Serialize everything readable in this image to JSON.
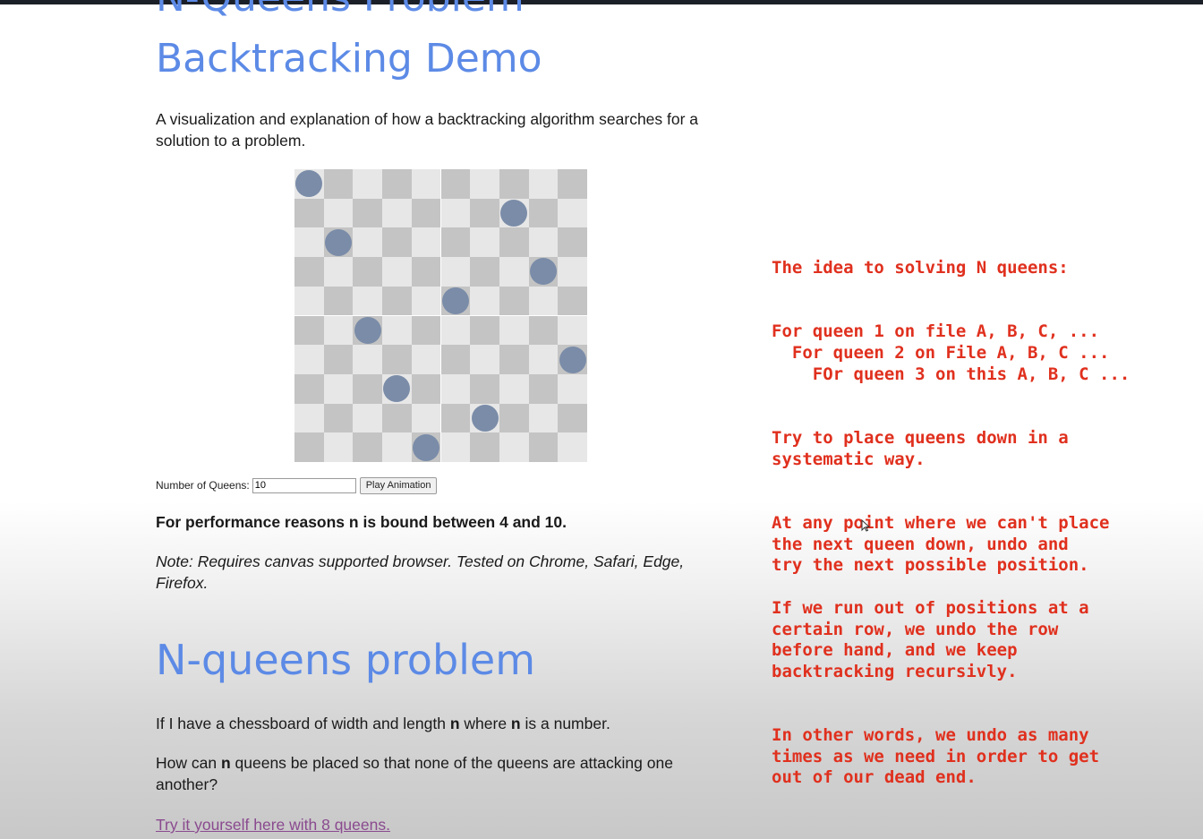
{
  "page": {
    "title_line1": "N-Queens Problem",
    "title_line2": "Backtracking Demo",
    "intro": "A visualization and explanation of how a backtracking algorithm searches for a solution to a problem.",
    "controls": {
      "queens_label": "Number of Queens:",
      "queens_value": "10",
      "play_button": "Play Animation"
    },
    "bound_text": "For performance reasons n is bound between 4 and 10.",
    "browser_note": "Note: Requires canvas supported browser. Tested on Chrome, Safari, Edge, Firefox.",
    "section_heading": "N-queens problem",
    "q1_prefix": "If I have a chessboard of width and length ",
    "q1_n1": "n",
    "q1_mid": " where ",
    "q1_n2": "n",
    "q1_suffix": " is a number.",
    "q2_prefix": "How can ",
    "q2_n": "n",
    "q2_suffix": " queens be placed so that none of the queens are attacking one another?",
    "try_link": "Try it yourself here with 8 queens."
  },
  "board": {
    "size": 10,
    "queen_color": "#7a8ca8",
    "light_color": "#e7e7e7",
    "dark_color": "#c4c4c4",
    "queens": [
      {
        "row": 0,
        "col": 0
      },
      {
        "row": 1,
        "col": 7
      },
      {
        "row": 2,
        "col": 1
      },
      {
        "row": 3,
        "col": 8
      },
      {
        "row": 4,
        "col": 5
      },
      {
        "row": 5,
        "col": 2
      },
      {
        "row": 6,
        "col": 9
      },
      {
        "row": 7,
        "col": 3
      },
      {
        "row": 8,
        "col": 6
      },
      {
        "row": 9,
        "col": 4
      }
    ]
  },
  "annotations": {
    "color": "#e0301e",
    "idea": "The idea to solving N queens:",
    "loop_1": "For queen 1 on file A, B, C, ...",
    "loop_2": "  For queen 2 on File A, B, C ...",
    "loop_3": "    FOr queen 3 on this A, B, C ...",
    "systematic_1": "Try to place queens down in a",
    "systematic_2": "systematic way.",
    "undo_1": "At any point where we can't place",
    "undo_2": "the next queen down, undo and",
    "undo_3": "try the next possible position.",
    "row_1": "If we run out of positions at a",
    "row_2": "certain row, we undo the row",
    "row_3": "before hand, and we keep",
    "row_4": "backtracking recursivly.",
    "other_1": "In other words, we undo as many",
    "other_2": "times as we need in order to get",
    "other_3": "out of our dead end."
  }
}
